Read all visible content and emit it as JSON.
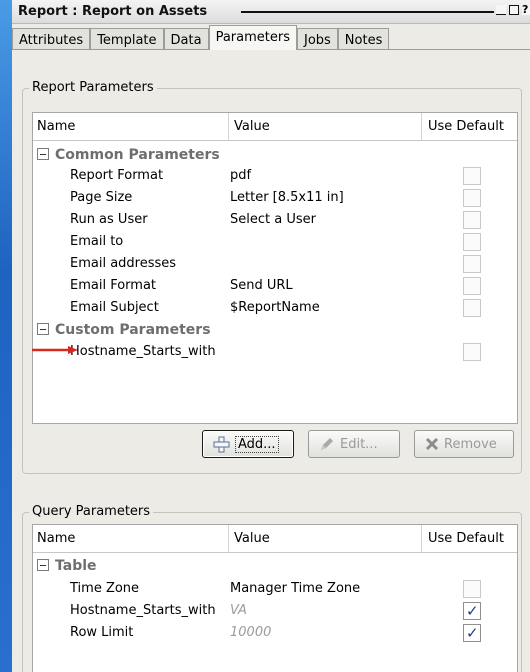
{
  "window": {
    "title": "Report : Report on Assets",
    "help_glyph": "?"
  },
  "tabs": [
    {
      "label": "Attributes"
    },
    {
      "label": "Template"
    },
    {
      "label": "Data"
    },
    {
      "label": "Parameters",
      "active": true
    },
    {
      "label": "Jobs"
    },
    {
      "label": "Notes"
    }
  ],
  "report_parameters": {
    "legend": "Report Parameters",
    "columns": {
      "name": "Name",
      "value": "Value",
      "use_default": "Use Default"
    },
    "groups": [
      {
        "label": "Common Parameters",
        "rows": [
          {
            "name": "Report Format",
            "value": "pdf",
            "use_default": false
          },
          {
            "name": "Page Size",
            "value": "Letter [8.5x11 in]",
            "use_default": false
          },
          {
            "name": "Run as User",
            "value": "Select a User",
            "use_default": false
          },
          {
            "name": "Email to",
            "value": "",
            "use_default": false
          },
          {
            "name": "Email addresses",
            "value": "",
            "use_default": false
          },
          {
            "name": "Email Format",
            "value": "Send URL",
            "use_default": false
          },
          {
            "name": "Email Subject",
            "value": "$ReportName",
            "use_default": false
          }
        ]
      },
      {
        "label": "Custom Parameters",
        "rows": [
          {
            "name": "Hostname_Starts_with",
            "value": "",
            "use_default": false
          }
        ]
      }
    ],
    "buttons": {
      "add": "Add...",
      "edit": "Edit...",
      "remove": "Remove"
    }
  },
  "query_parameters": {
    "legend": "Query Parameters",
    "columns": {
      "name": "Name",
      "value": "Value",
      "use_default": "Use Default"
    },
    "groups": [
      {
        "label": "Table",
        "rows": [
          {
            "name": "Time Zone",
            "value": "Manager Time Zone",
            "use_default": false
          },
          {
            "name": "Hostname_Starts_with",
            "value": "VA",
            "use_default": true
          },
          {
            "name": "Row Limit",
            "value": "10000",
            "use_default": true
          }
        ]
      }
    ]
  },
  "colors": {
    "arrow": "#d9281f",
    "accent": "#1a3e8c"
  }
}
